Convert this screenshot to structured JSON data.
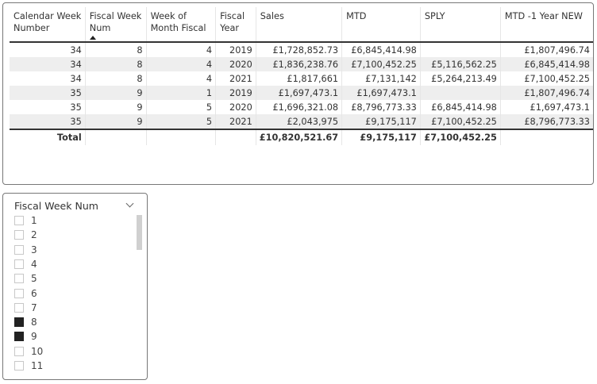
{
  "table": {
    "columns": [
      {
        "label": "Calendar Week Number"
      },
      {
        "label": "Fiscal Week Num",
        "sorted": "ascending"
      },
      {
        "label": "Week of Month Fiscal"
      },
      {
        "label": "Fiscal Year"
      },
      {
        "label": "Sales"
      },
      {
        "label": "MTD"
      },
      {
        "label": "SPLY"
      },
      {
        "label": "MTD -1 Year NEW"
      }
    ],
    "rows": [
      [
        "34",
        "8",
        "4",
        "2019",
        "£1,728,852.73",
        "£6,845,414.98",
        "",
        "£1,807,496.74"
      ],
      [
        "34",
        "8",
        "4",
        "2020",
        "£1,836,238.76",
        "£7,100,452.25",
        "£5,116,562.25",
        "£6,845,414.98"
      ],
      [
        "34",
        "8",
        "4",
        "2021",
        "£1,817,661",
        "£7,131,142",
        "£5,264,213.49",
        "£7,100,452.25"
      ],
      [
        "35",
        "9",
        "1",
        "2019",
        "£1,697,473.1",
        "£1,697,473.1",
        "",
        "£1,807,496.74"
      ],
      [
        "35",
        "9",
        "5",
        "2020",
        "£1,696,321.08",
        "£8,796,773.33",
        "£6,845,414.98",
        "£1,697,473.1"
      ],
      [
        "35",
        "9",
        "5",
        "2021",
        "£2,043,975",
        "£9,175,117",
        "£7,100,452.25",
        "£8,796,773.33"
      ]
    ],
    "total": [
      "Total",
      "",
      "",
      "",
      "£10,820,521.67",
      "£9,175,117",
      "£7,100,452.25",
      ""
    ]
  },
  "slicer": {
    "title": "Fiscal Week Num",
    "items": [
      {
        "label": "1",
        "checked": false
      },
      {
        "label": "2",
        "checked": false
      },
      {
        "label": "3",
        "checked": false
      },
      {
        "label": "4",
        "checked": false
      },
      {
        "label": "5",
        "checked": false
      },
      {
        "label": "6",
        "checked": false
      },
      {
        "label": "7",
        "checked": false
      },
      {
        "label": "8",
        "checked": true
      },
      {
        "label": "9",
        "checked": true
      },
      {
        "label": "10",
        "checked": false
      },
      {
        "label": "11",
        "checked": false
      }
    ]
  }
}
